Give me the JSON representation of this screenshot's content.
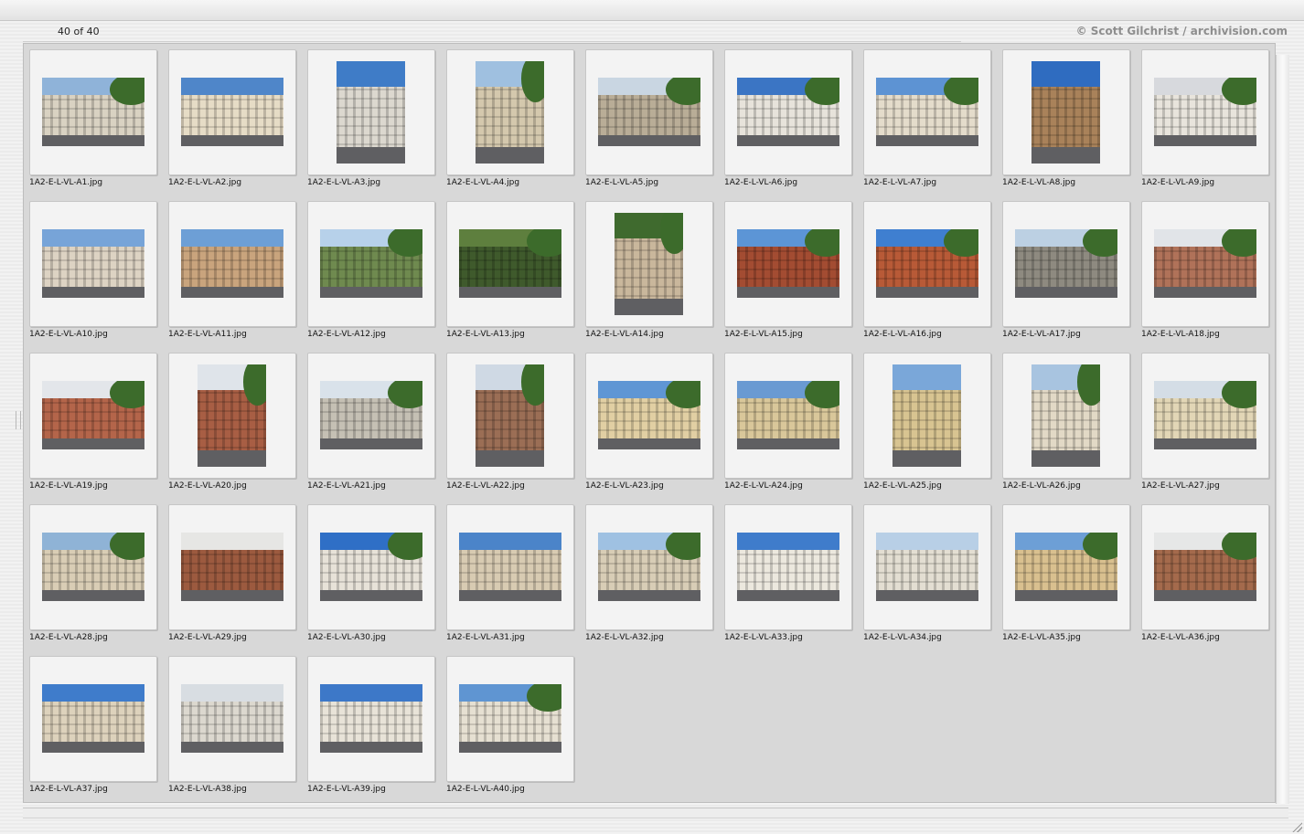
{
  "header": {
    "count_label": "40 of 40",
    "credit": "© Scott Gilchrist / archivision.com"
  },
  "grid": {
    "columns": 9
  },
  "images": [
    {
      "file": "1A2-E-L-VL-A1.jpg",
      "orientation": "landscape",
      "sky": "#8fb3d9",
      "building": "#d9d2c2",
      "tree": true
    },
    {
      "file": "1A2-E-L-VL-A2.jpg",
      "orientation": "landscape",
      "sky": "#4f86c9",
      "building": "#e6dcc6",
      "tree": false
    },
    {
      "file": "1A2-E-L-VL-A3.jpg",
      "orientation": "portrait",
      "sky": "#3f7cc7",
      "building": "#dcd8cf",
      "tree": false
    },
    {
      "file": "1A2-E-L-VL-A4.jpg",
      "orientation": "portrait",
      "sky": "#9fc0e0",
      "building": "#d4c8ad",
      "tree": true
    },
    {
      "file": "1A2-E-L-VL-A5.jpg",
      "orientation": "landscape",
      "sky": "#c9d6e2",
      "building": "#b9ad97",
      "tree": true
    },
    {
      "file": "1A2-E-L-VL-A6.jpg",
      "orientation": "landscape",
      "sky": "#3b75c4",
      "building": "#e7e3db",
      "tree": true
    },
    {
      "file": "1A2-E-L-VL-A7.jpg",
      "orientation": "landscape",
      "sky": "#5d93d3",
      "building": "#e4dccb",
      "tree": true
    },
    {
      "file": "1A2-E-L-VL-A8.jpg",
      "orientation": "portrait",
      "sky": "#2f6cc0",
      "building": "#a9825a",
      "tree": false
    },
    {
      "file": "1A2-E-L-VL-A9.jpg",
      "orientation": "landscape",
      "sky": "#d7d9dd",
      "building": "#e8e4dc",
      "tree": true
    },
    {
      "file": "1A2-E-L-VL-A10.jpg",
      "orientation": "landscape",
      "sky": "#77a4d8",
      "building": "#ddd3c3",
      "tree": false
    },
    {
      "file": "1A2-E-L-VL-A11.jpg",
      "orientation": "landscape",
      "sky": "#6d9fd6",
      "building": "#c9a47d",
      "tree": false
    },
    {
      "file": "1A2-E-L-VL-A12.jpg",
      "orientation": "landscape",
      "sky": "#b7d1ea",
      "building": "#6f8a4f",
      "tree": true
    },
    {
      "file": "1A2-E-L-VL-A13.jpg",
      "orientation": "landscape",
      "sky": "#5e7f3e",
      "building": "#3f5a2c",
      "tree": true
    },
    {
      "file": "1A2-E-L-VL-A14.jpg",
      "orientation": "portrait",
      "sky": "#3f6a2e",
      "building": "#c9b79c",
      "tree": true
    },
    {
      "file": "1A2-E-L-VL-A15.jpg",
      "orientation": "landscape",
      "sky": "#5c95d6",
      "building": "#a34c32",
      "tree": true
    },
    {
      "file": "1A2-E-L-VL-A16.jpg",
      "orientation": "landscape",
      "sky": "#3f7fd0",
      "building": "#b85a37",
      "tree": true
    },
    {
      "file": "1A2-E-L-VL-A17.jpg",
      "orientation": "landscape",
      "sky": "#bcd0e3",
      "building": "#8e8a80",
      "tree": true
    },
    {
      "file": "1A2-E-L-VL-A18.jpg",
      "orientation": "landscape",
      "sky": "#e1e4e8",
      "building": "#b07259",
      "tree": true
    },
    {
      "file": "1A2-E-L-VL-A19.jpg",
      "orientation": "landscape",
      "sky": "#e3e6ea",
      "building": "#b4654a",
      "tree": true
    },
    {
      "file": "1A2-E-L-VL-A20.jpg",
      "orientation": "portrait",
      "sky": "#dfe4ea",
      "building": "#a85e44",
      "tree": true
    },
    {
      "file": "1A2-E-L-VL-A21.jpg",
      "orientation": "landscape",
      "sky": "#d9e2ea",
      "building": "#c5c0b4",
      "tree": true
    },
    {
      "file": "1A2-E-L-VL-A22.jpg",
      "orientation": "portrait",
      "sky": "#cfd9e4",
      "building": "#9b6e55",
      "tree": true
    },
    {
      "file": "1A2-E-L-VL-A23.jpg",
      "orientation": "landscape",
      "sky": "#5f96d4",
      "building": "#e1cfa3",
      "tree": true
    },
    {
      "file": "1A2-E-L-VL-A24.jpg",
      "orientation": "landscape",
      "sky": "#6a9ad2",
      "building": "#d9c79a",
      "tree": true
    },
    {
      "file": "1A2-E-L-VL-A25.jpg",
      "orientation": "portrait",
      "sky": "#7aa7d9",
      "building": "#d8c491",
      "tree": false
    },
    {
      "file": "1A2-E-L-VL-A26.jpg",
      "orientation": "portrait",
      "sky": "#a8c4e0",
      "building": "#e2d9c6",
      "tree": true
    },
    {
      "file": "1A2-E-L-VL-A27.jpg",
      "orientation": "landscape",
      "sky": "#d4dde6",
      "building": "#e2d6b6",
      "tree": true
    },
    {
      "file": "1A2-E-L-VL-A28.jpg",
      "orientation": "landscape",
      "sky": "#8fb3d6",
      "building": "#d9cdb5",
      "tree": true
    },
    {
      "file": "1A2-E-L-VL-A29.jpg",
      "orientation": "landscape",
      "sky": "#e6e6e4",
      "building": "#9c5a3f",
      "tree": false
    },
    {
      "file": "1A2-E-L-VL-A30.jpg",
      "orientation": "landscape",
      "sky": "#2f6fc6",
      "building": "#e7e2d8",
      "tree": true
    },
    {
      "file": "1A2-E-L-VL-A31.jpg",
      "orientation": "landscape",
      "sky": "#4b84c9",
      "building": "#d8cbb2",
      "tree": false
    },
    {
      "file": "1A2-E-L-VL-A32.jpg",
      "orientation": "landscape",
      "sky": "#9fc1e2",
      "building": "#d8cdb6",
      "tree": true
    },
    {
      "file": "1A2-E-L-VL-A33.jpg",
      "orientation": "landscape",
      "sky": "#3f7ccb",
      "building": "#ece8de",
      "tree": false
    },
    {
      "file": "1A2-E-L-VL-A34.jpg",
      "orientation": "landscape",
      "sky": "#b8cfe6",
      "building": "#e3ded2",
      "tree": false
    },
    {
      "file": "1A2-E-L-VL-A35.jpg",
      "orientation": "landscape",
      "sky": "#6d9fd6",
      "building": "#d9c08f",
      "tree": true
    },
    {
      "file": "1A2-E-L-VL-A36.jpg",
      "orientation": "landscape",
      "sky": "#e6e7e7",
      "building": "#a46a4c",
      "tree": true
    },
    {
      "file": "1A2-E-L-VL-A37.jpg",
      "orientation": "landscape",
      "sky": "#3f7ccb",
      "building": "#ddd2bc",
      "tree": false
    },
    {
      "file": "1A2-E-L-VL-A38.jpg",
      "orientation": "landscape",
      "sky": "#d8dde2",
      "building": "#dcd8cf",
      "tree": false
    },
    {
      "file": "1A2-E-L-VL-A39.jpg",
      "orientation": "landscape",
      "sky": "#3d78c8",
      "building": "#e8e3d8",
      "tree": false
    },
    {
      "file": "1A2-E-L-VL-A40.jpg",
      "orientation": "landscape",
      "sky": "#5f95d2",
      "building": "#e6e0d2",
      "tree": true
    }
  ]
}
